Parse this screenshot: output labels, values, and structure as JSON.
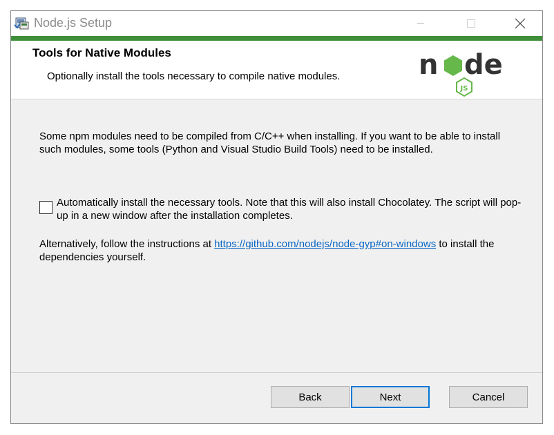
{
  "window": {
    "title": "Node.js Setup",
    "accent_color": "#3f8f3a"
  },
  "header": {
    "title": "Tools for Native Modules",
    "subtitle": "Optionally install the tools necessary to compile native modules.",
    "logo": {
      "word_before": "n",
      "word_after": "de",
      "badge": "JS"
    }
  },
  "content": {
    "paragraph1": "Some npm modules need to be compiled from C/C++ when installing. If you want to be able to install such modules, some tools (Python and Visual Studio Build Tools) need to be installed.",
    "checkbox": {
      "checked": false,
      "label": "Automatically install the necessary tools. Note that this will also install Chocolatey. The script will pop-up in a new window after the installation completes."
    },
    "paragraph2": {
      "before_link": "Alternatively, follow the instructions at ",
      "link_text": "https://github.com/nodejs/node-gyp#on-windows",
      "after_link": " to install the dependencies yourself."
    }
  },
  "footer": {
    "back_label": "Back",
    "next_label": "Next",
    "cancel_label": "Cancel"
  }
}
